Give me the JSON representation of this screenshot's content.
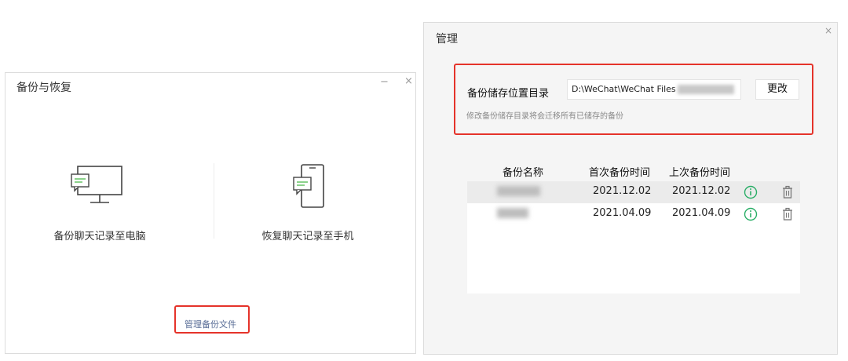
{
  "left_window": {
    "title": "备份与恢复",
    "minimize_label": "−",
    "close_label": "×",
    "backup_option": {
      "label": "备份聊天记录至电脑",
      "icon": "monitor-chat-icon"
    },
    "restore_option": {
      "label": "恢复聊天记录至手机",
      "icon": "phone-chat-icon"
    },
    "manage_link": "管理备份文件"
  },
  "right_window": {
    "title": "管理",
    "close_label": "×",
    "storage": {
      "label": "备份储存位置目录",
      "path": "D:\\WeChat\\WeChat Files",
      "change_button": "更改",
      "hint": "修改备份储存目录将会迁移所有已储存的备份"
    },
    "table": {
      "columns": [
        "备份名称",
        "首次备份时间",
        "上次备份时间"
      ],
      "rows": [
        {
          "first_backup": "2021.12.02",
          "last_backup": "2021.12.02"
        },
        {
          "first_backup": "2021.04.09",
          "last_backup": "2021.04.09"
        }
      ]
    }
  },
  "colors": {
    "highlight": "#e5332a",
    "link": "#576b95",
    "chat_green": "#5bbf5b",
    "info_green": "#2aae67",
    "selected_row": "#ebebeb"
  }
}
